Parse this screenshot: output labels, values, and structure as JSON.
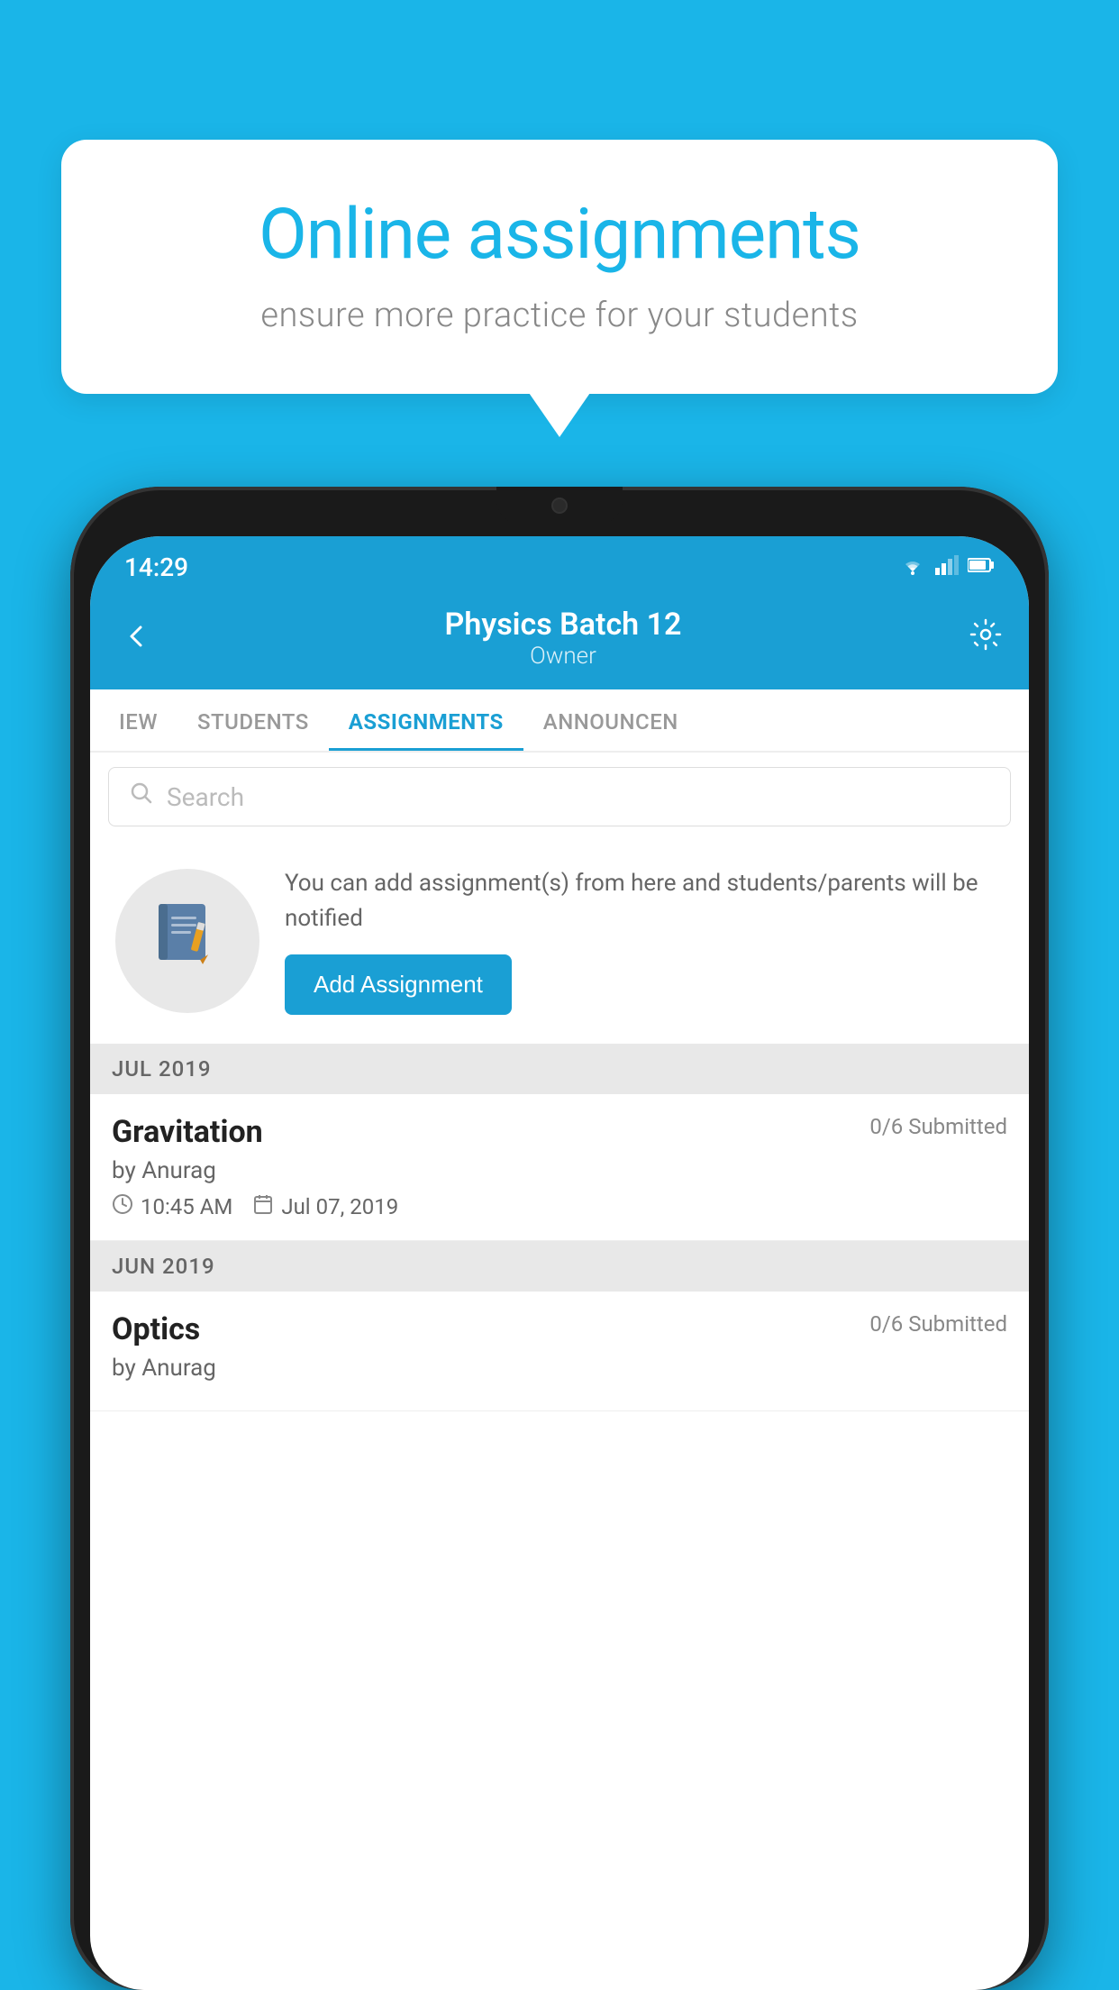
{
  "background_color": "#1ab5e8",
  "speech_bubble": {
    "heading": "Online assignments",
    "subtext": "ensure more practice for your students"
  },
  "phone": {
    "status_bar": {
      "time": "14:29",
      "wifi": "▾",
      "signal": "▴▴",
      "battery": "▮"
    },
    "header": {
      "title": "Physics Batch 12",
      "subtitle": "Owner",
      "back_label": "←",
      "settings_label": "⚙"
    },
    "tabs": [
      {
        "label": "IEW",
        "active": false
      },
      {
        "label": "STUDENTS",
        "active": false
      },
      {
        "label": "ASSIGNMENTS",
        "active": true
      },
      {
        "label": "ANNOUNCEMENTS",
        "active": false
      }
    ],
    "search": {
      "placeholder": "Search"
    },
    "promo_card": {
      "description": "You can add assignment(s) from here and students/parents will be notified",
      "button_label": "Add Assignment"
    },
    "sections": [
      {
        "label": "JUL 2019",
        "assignments": [
          {
            "title": "Gravitation",
            "submitted": "0/6 Submitted",
            "author": "by Anurag",
            "time": "10:45 AM",
            "date": "Jul 07, 2019"
          }
        ]
      },
      {
        "label": "JUN 2019",
        "assignments": [
          {
            "title": "Optics",
            "submitted": "0/6 Submitted",
            "author": "by Anurag",
            "time": "",
            "date": ""
          }
        ]
      }
    ]
  }
}
